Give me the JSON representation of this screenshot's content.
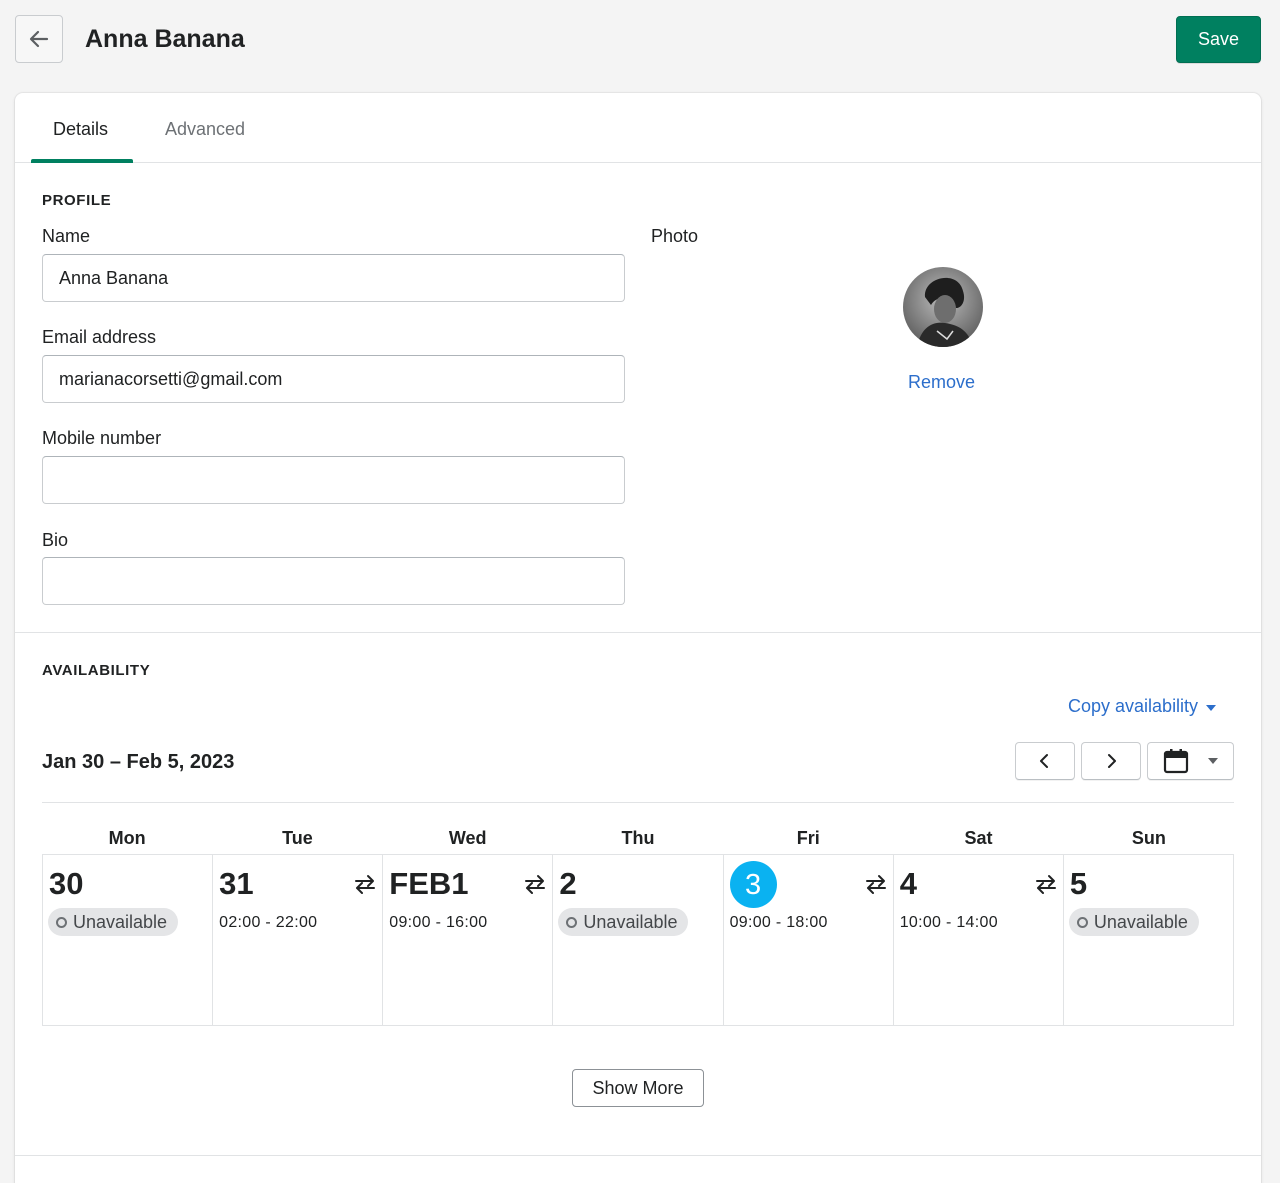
{
  "header": {
    "title": "Anna Banana",
    "back_icon": "arrow-left-icon",
    "save_label": "Save"
  },
  "colors": {
    "primary": "#008060",
    "link": "#2c6ecb",
    "today": "#0ab2f1",
    "badge_bg": "#e4e5e7"
  },
  "tabs": [
    {
      "label": "Details",
      "active": true
    },
    {
      "label": "Advanced",
      "active": false
    }
  ],
  "profile": {
    "section_title": "PROFILE",
    "name_label": "Name",
    "name_value": "Anna Banana",
    "email_label": "Email address",
    "email_value": "marianacorsetti@gmail.com",
    "mobile_label": "Mobile number",
    "mobile_value": "",
    "bio_label": "Bio",
    "bio_value": "",
    "photo_label": "Photo",
    "remove_label": "Remove"
  },
  "availability": {
    "section_title": "AVAILABILITY",
    "copy_label": "Copy availability",
    "date_range": "Jan 30 – Feb 5, 2023",
    "prev_icon": "chevron-left-icon",
    "next_icon": "chevron-right-icon",
    "calendar_icon": "calendar-icon",
    "day_names": [
      "Mon",
      "Tue",
      "Wed",
      "Thu",
      "Fri",
      "Sat",
      "Sun"
    ],
    "days": [
      {
        "num": "30",
        "status": "Unavailable",
        "hours": "",
        "swap": false,
        "today": false
      },
      {
        "num": "31",
        "status": "",
        "hours": "02:00 - 22:00",
        "swap": true,
        "today": false
      },
      {
        "num": "FEB1",
        "status": "",
        "hours": "09:00 - 16:00",
        "swap": true,
        "today": false
      },
      {
        "num": "2",
        "status": "Unavailable",
        "hours": "",
        "swap": false,
        "today": false
      },
      {
        "num": "3",
        "status": "",
        "hours": "09:00 - 18:00",
        "swap": true,
        "today": true
      },
      {
        "num": "4",
        "status": "",
        "hours": "10:00 - 14:00",
        "swap": true,
        "today": false
      },
      {
        "num": "5",
        "status": "Unavailable",
        "hours": "",
        "swap": false,
        "today": false
      }
    ],
    "show_more_label": "Show More"
  }
}
